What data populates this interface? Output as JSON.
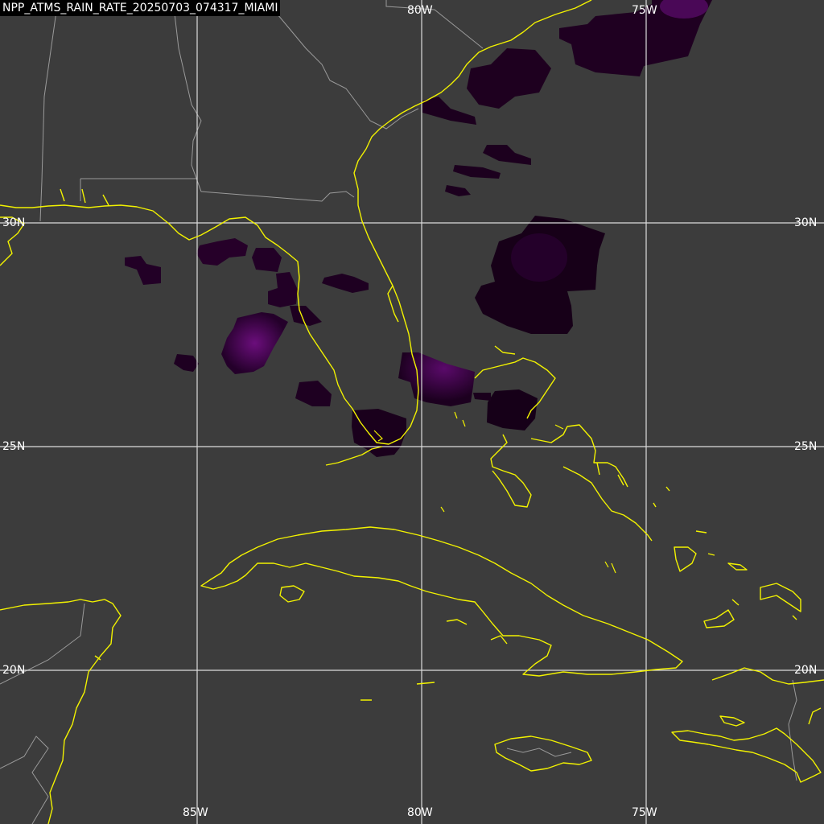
{
  "title": "NPP_ATMS_RAIN_RATE_20250703_074317_MIAMI",
  "graticule": {
    "lon_labels": [
      "85W",
      "80W",
      "75W"
    ],
    "lat_labels": [
      "30N",
      "25N",
      "20N"
    ]
  },
  "colors": {
    "background": "#3c3c3c",
    "coastline": "#f2f200",
    "borders": "#9a9a9a",
    "grid": "#dcdcdc",
    "rain_dark": "#1f001f",
    "rain_light": "#5a0a6a"
  },
  "icons": [
    "rain-rate-swath",
    "coastline",
    "state-border"
  ]
}
